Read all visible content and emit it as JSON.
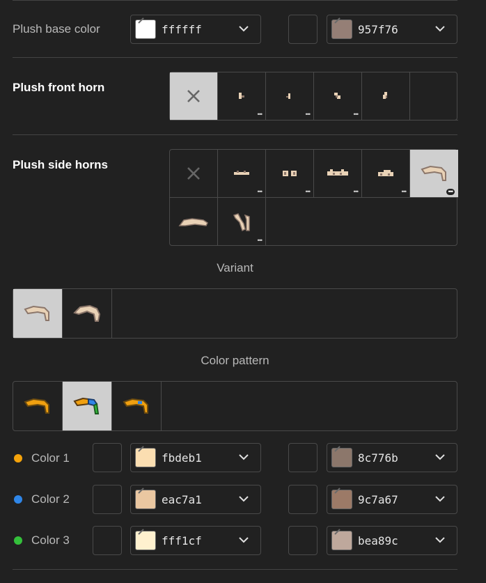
{
  "base_color": {
    "label": "Plush base color",
    "primary": {
      "hex": "ffffff",
      "swatch": "#ffffff"
    },
    "secondary": {
      "hex": "957f76",
      "swatch": "#957f76"
    }
  },
  "front_horn": {
    "label": "Plush front horn",
    "selected_index": 0
  },
  "side_horns": {
    "label": "Plush side horns",
    "selected_index": 5
  },
  "variant": {
    "title": "Variant",
    "selected_index": 0
  },
  "color_pattern": {
    "title": "Color pattern",
    "selected_index": 1
  },
  "colors": [
    {
      "label": "Color 1",
      "dot": "#f5a30b",
      "primary": {
        "hex": "fbdeb1",
        "swatch": "#fbdeb1"
      },
      "secondary": {
        "hex": "8c776b",
        "swatch": "#8c776b"
      }
    },
    {
      "label": "Color 2",
      "dot": "#2f86e8",
      "primary": {
        "hex": "eac7a1",
        "swatch": "#eac7a1"
      },
      "secondary": {
        "hex": "9c7a67",
        "swatch": "#9c7a67"
      }
    },
    {
      "label": "Color 3",
      "dot": "#34c03b",
      "primary": {
        "hex": "fff1cf",
        "swatch": "#fff1cf"
      },
      "secondary": {
        "hex": "bea89c",
        "swatch": "#bea89c"
      }
    }
  ],
  "icons": {
    "more": "•••",
    "none": "close-icon",
    "dropdown": "chevron-down-icon"
  }
}
